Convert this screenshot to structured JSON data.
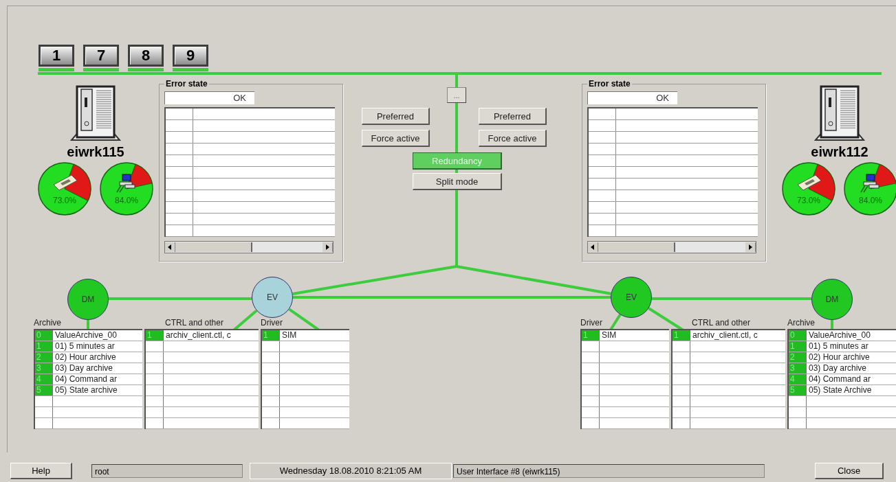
{
  "node_buttons": [
    {
      "label": "1",
      "connected": true
    },
    {
      "label": "7",
      "connected": true
    },
    {
      "label": "8",
      "connected": true
    },
    {
      "label": "9",
      "connected": true
    }
  ],
  "servers": [
    {
      "name": "eiwrk115",
      "error_panel": {
        "title": "Error state",
        "status": "OK"
      },
      "gauges": [
        {
          "kind": "memory",
          "reading": "73.0%"
        },
        {
          "kind": "network",
          "reading": "84.0%"
        }
      ]
    },
    {
      "name": "eiwrk112",
      "error_panel": {
        "title": "Error state",
        "status": "OK"
      },
      "gauges": [
        {
          "kind": "memory",
          "reading": "73.0%"
        },
        {
          "kind": "network",
          "reading": "84.0%"
        }
      ]
    }
  ],
  "controls": {
    "more_button": "...",
    "left": [
      "Preferred",
      "Force active"
    ],
    "right": [
      "Preferred",
      "Force active"
    ],
    "modes": [
      {
        "label": "Redundancy",
        "active": true
      },
      {
        "label": "Split mode",
        "active": false
      }
    ]
  },
  "managers": [
    {
      "label": "DM",
      "color": "#22c822"
    },
    {
      "label": "EV",
      "color": "#a9d3db"
    },
    {
      "label": "EV",
      "color": "#22c822"
    },
    {
      "label": "DM",
      "color": "#22c822"
    }
  ],
  "tables": [
    {
      "kind": "archive",
      "title": "Archive",
      "rows": [
        {
          "index": "0",
          "text": "ValueArchive_00"
        },
        {
          "index": "1",
          "text": "01) 5 minutes ar"
        },
        {
          "index": "2",
          "text": "02) Hour archive"
        },
        {
          "index": "3",
          "text": "03) Day archive"
        },
        {
          "index": "4",
          "text": "04) Command ar"
        },
        {
          "index": "5",
          "text": "05) State archive"
        }
      ]
    },
    {
      "kind": "ctrl",
      "title": "CTRL and other",
      "rows": [
        {
          "index": "1",
          "text": "archiv_client.ctl, c"
        }
      ]
    },
    {
      "kind": "driver",
      "title": "Driver",
      "rows": [
        {
          "index": "1",
          "text": "SIM"
        }
      ]
    },
    {
      "kind": "driver",
      "title": "Driver",
      "rows": [
        {
          "index": "1",
          "text": "SIM"
        }
      ]
    },
    {
      "kind": "ctrl",
      "title": "CTRL and other",
      "rows": [
        {
          "index": "1",
          "text": "archiv_client.ctl, c"
        }
      ]
    },
    {
      "kind": "archive",
      "title": "Archive",
      "rows": [
        {
          "index": "0",
          "text": "ValueArchive_00"
        },
        {
          "index": "1",
          "text": "01) 5 minutes ar"
        },
        {
          "index": "2",
          "text": "02) Hour archive"
        },
        {
          "index": "3",
          "text": "03) Day archive"
        },
        {
          "index": "4",
          "text": "04) Command ar"
        },
        {
          "index": "5",
          "text": "05) State Archive"
        }
      ]
    }
  ],
  "status_bar": {
    "help": "Help",
    "user": "root",
    "datetime": "Wednesday 18.08.2010  8:21:05 AM",
    "interface": "User Interface #8 (eiwrk115)",
    "close": "Close"
  }
}
